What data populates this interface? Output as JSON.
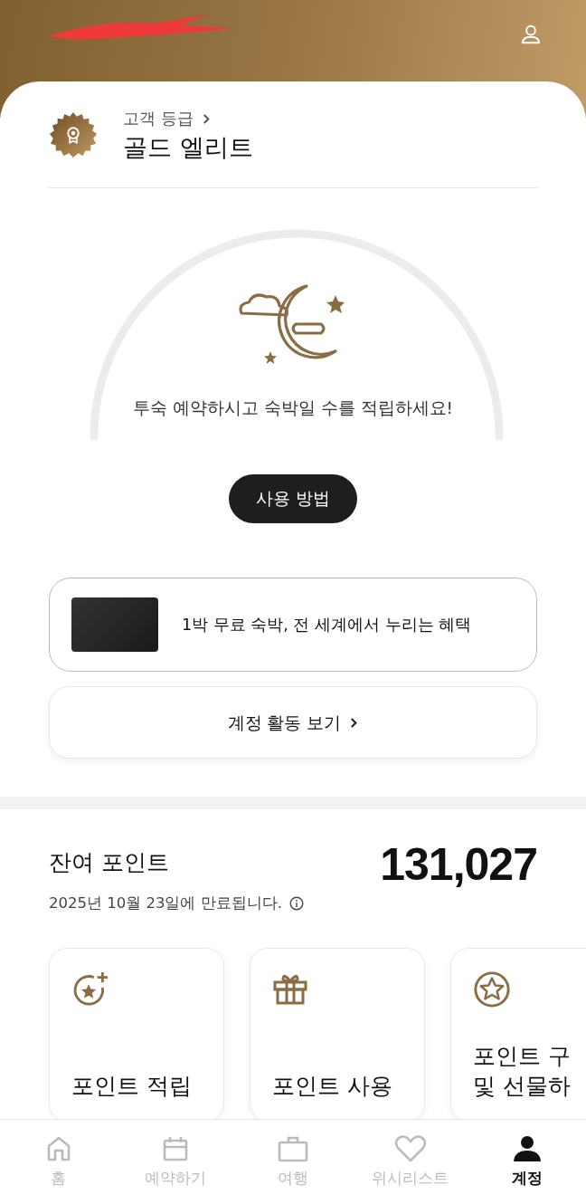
{
  "header": {
    "name_redacted": true
  },
  "tier": {
    "label": "고객 등급",
    "name": "골드 엘리트"
  },
  "stays": {
    "message": "투숙 예약하시고 숙박일 수를 적립하세요!",
    "button": "사용 방법"
  },
  "card_offer": {
    "text": "1박 무료 숙박, 전 세계에서 누리는 혜택"
  },
  "activity_link": {
    "label": "계정 활동 보기"
  },
  "points": {
    "title": "잔여 포인트",
    "expiry": "2025년 10월 23일에 만료됩니다.",
    "balance": "131,027"
  },
  "actions": [
    {
      "kind": "earn",
      "lines": [
        "포인트 적립"
      ]
    },
    {
      "kind": "redeem",
      "lines": [
        "포인트 사용"
      ]
    },
    {
      "kind": "buy",
      "lines": [
        "포인트 구",
        "및 선물하"
      ]
    }
  ],
  "nav": [
    {
      "kind": "home",
      "label": "홈",
      "selected": false
    },
    {
      "kind": "book",
      "label": "예약하기",
      "selected": false
    },
    {
      "kind": "trips",
      "label": "여행",
      "selected": false
    },
    {
      "kind": "wishlist",
      "label": "위시리스트",
      "selected": false
    },
    {
      "kind": "account",
      "label": "계정",
      "selected": true
    }
  ]
}
